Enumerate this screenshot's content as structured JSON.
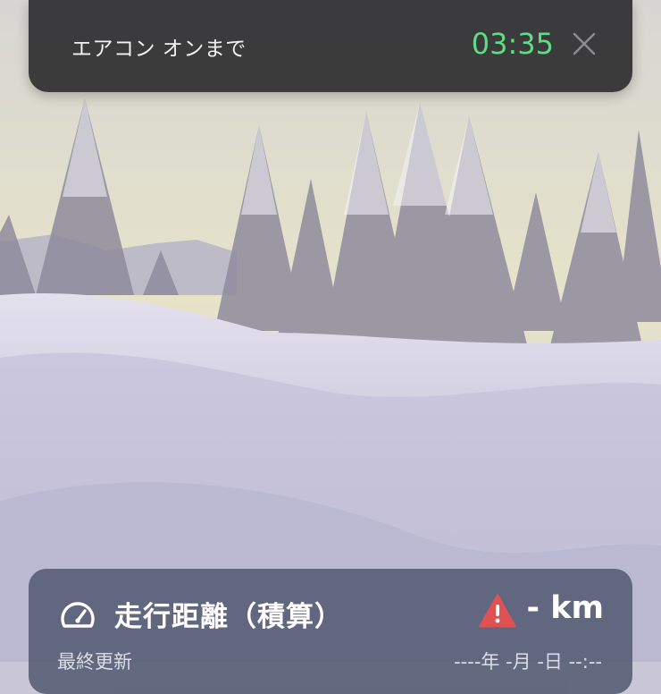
{
  "background": {
    "scene": "snowy-forest-photo"
  },
  "toast": {
    "label": "エアコン オンまで",
    "countdown": "03:35",
    "close_icon": "close-icon",
    "countdown_color": "#5fdc86"
  },
  "odometer_card": {
    "icon": "speedometer-icon",
    "title": "走行距離（積算）",
    "warning_icon": "warning-icon",
    "warning_color": "#e05252",
    "value": "- km",
    "last_updated_label": "最終更新",
    "last_updated_value": "----年 -月 -日 --:--"
  }
}
